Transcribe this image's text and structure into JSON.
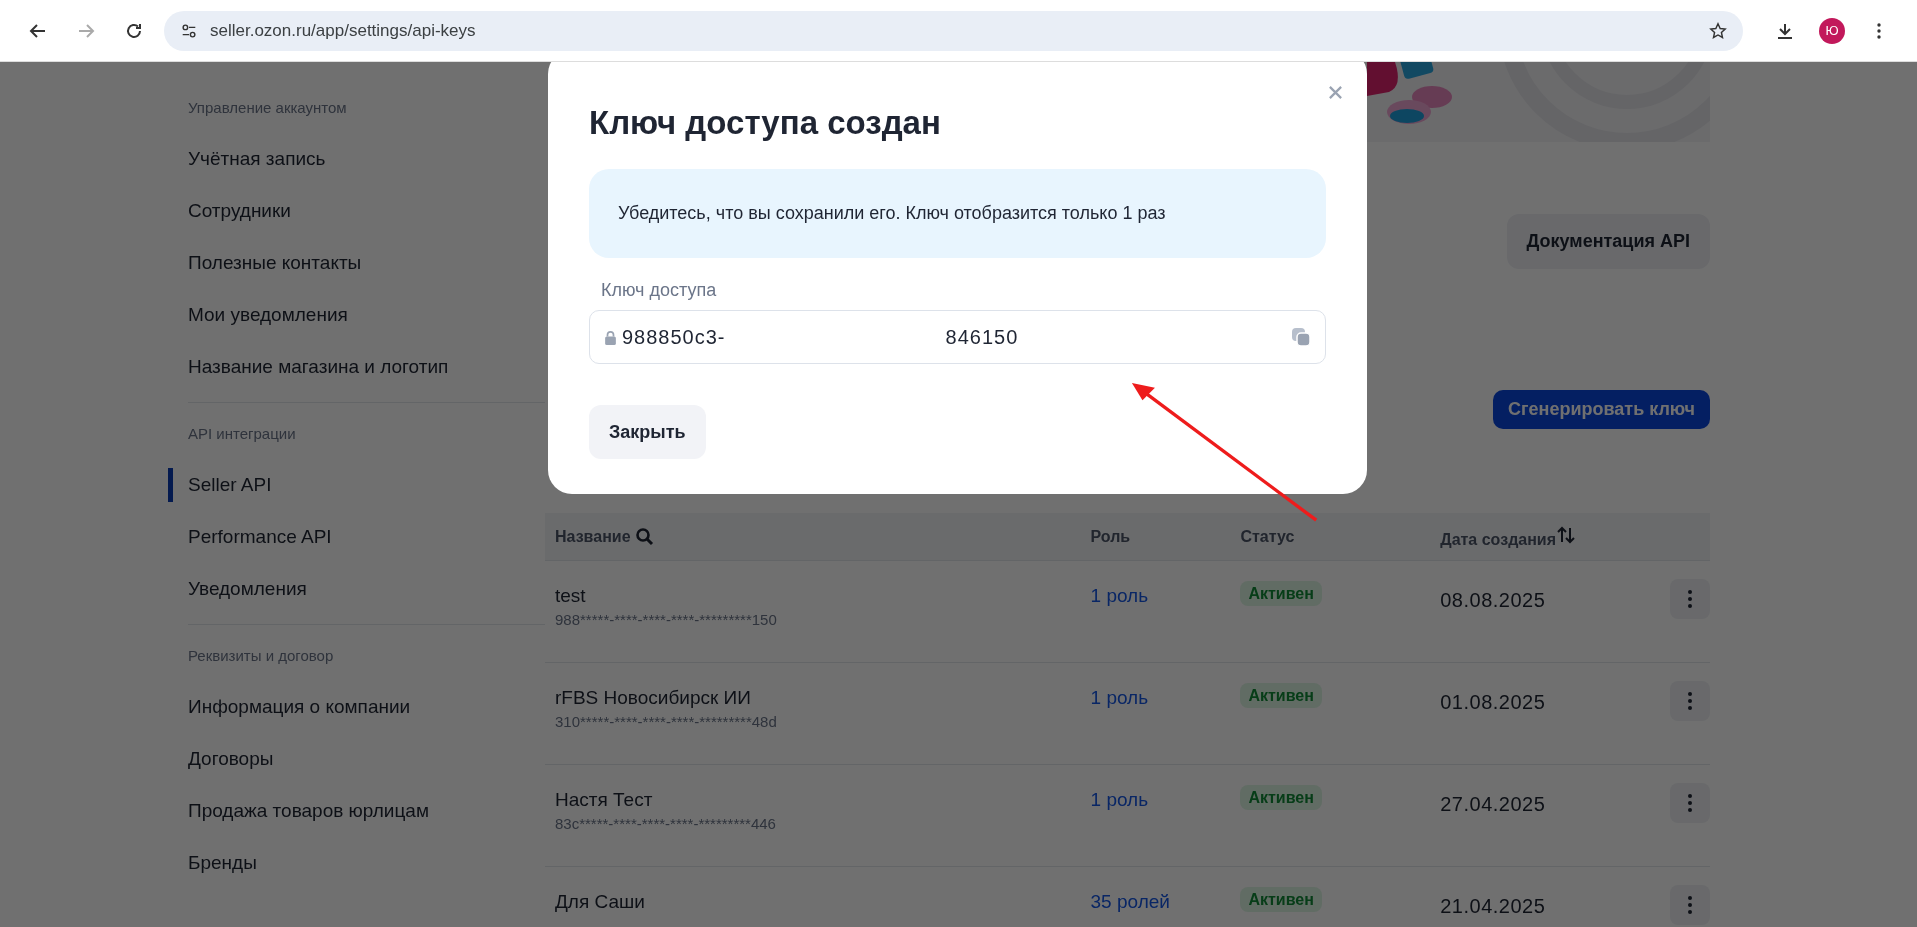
{
  "browser": {
    "url": "seller.ozon.ru/app/settings/api-keys",
    "avatar": "Ю"
  },
  "sidebar": {
    "groups": [
      {
        "title": "Управление аккаунтом",
        "items": [
          {
            "label": "Учётная запись",
            "selected": false
          },
          {
            "label": "Сотрудники",
            "selected": false
          },
          {
            "label": "Полезные контакты",
            "selected": false
          },
          {
            "label": "Мои уведомления",
            "selected": false
          },
          {
            "label": "Название магазина и логотип",
            "selected": false
          }
        ]
      },
      {
        "title": "API интеграции",
        "items": [
          {
            "label": "Seller API",
            "selected": true
          },
          {
            "label": "Performance API",
            "selected": false
          },
          {
            "label": "Уведомления",
            "selected": false
          }
        ]
      },
      {
        "title": "Реквизиты и договор",
        "items": [
          {
            "label": "Информация о компании",
            "selected": false
          },
          {
            "label": "Договоры",
            "selected": false
          },
          {
            "label": "Продажа товаров юрлицам",
            "selected": false
          },
          {
            "label": "Бренды",
            "selected": false
          }
        ]
      }
    ]
  },
  "main": {
    "docs_button": "Документация API",
    "generate_button": "Сгенерировать ключ",
    "table": {
      "columns": [
        "Название",
        "Роль",
        "Статус",
        "Дата создания"
      ],
      "rows": [
        {
          "name": "test",
          "key": "988*****-****-****-****-*********150",
          "role": "1 роль",
          "status": "Активен",
          "date": "08.08.2025"
        },
        {
          "name": "rFBS Новосибирск ИИ",
          "key": "310*****-****-****-****-*********48d",
          "role": "1 роль",
          "status": "Активен",
          "date": "01.08.2025"
        },
        {
          "name": "Настя Тест",
          "key": "83c*****-****-****-****-*********446",
          "role": "1 роль",
          "status": "Активен",
          "date": "27.04.2025"
        },
        {
          "name": "Для Саши",
          "role": "35 ролей",
          "status": "Активен",
          "date": "21.04.2025"
        }
      ]
    }
  },
  "modal": {
    "title": "Ключ доступа создан",
    "notice": "Убедитесь, что вы сохранили его. Ключ отобразится только 1 раз",
    "field_label": "Ключ доступа",
    "key_parts": [
      "988850c3-",
      "846150"
    ],
    "close_button": "Закрыть"
  }
}
